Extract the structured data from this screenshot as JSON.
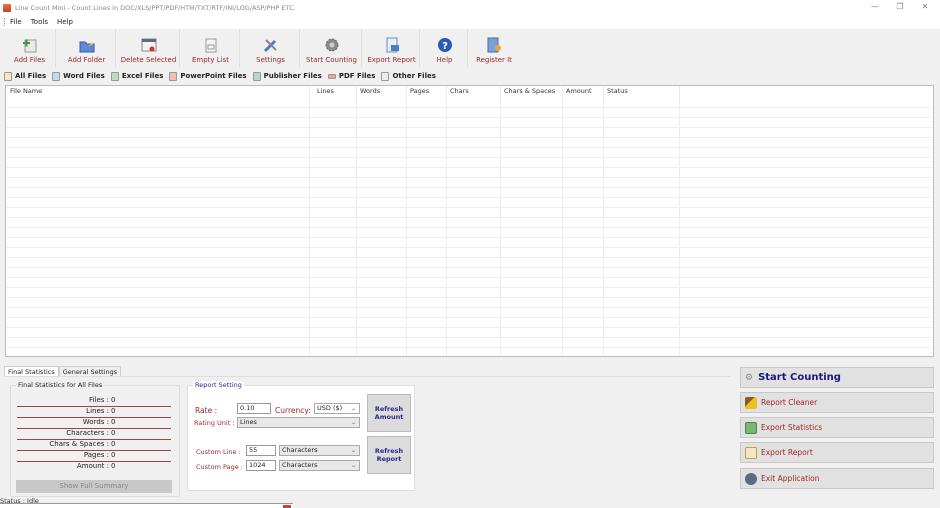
{
  "window": {
    "title": "Line Count Mini - Count Lines in DOC/XLS/PPT/PDF/HTM/TXT/RTF/INI/LOG/ASP/PHP ETC.",
    "minimize": "—",
    "restore": "❐",
    "close": "✕"
  },
  "menu": [
    "File",
    "Tools",
    "Help"
  ],
  "toolbar": [
    {
      "label": "Add Files",
      "icon": "add-files-icon"
    },
    {
      "label": "Add Folder",
      "icon": "add-folder-icon"
    },
    {
      "label": "Delete Selected",
      "icon": "delete-selected-icon"
    },
    {
      "label": "Empty List",
      "icon": "empty-list-icon"
    },
    {
      "label": "Settings",
      "icon": "settings-icon"
    },
    {
      "label": "Start Counting",
      "icon": "gear-icon"
    },
    {
      "label": "Export Report",
      "icon": "export-report-icon"
    },
    {
      "label": "Help",
      "icon": "help-icon"
    },
    {
      "label": "Register It",
      "icon": "register-icon"
    }
  ],
  "file_tabs": [
    {
      "label": "All Files",
      "color": "#d8c080"
    },
    {
      "label": "Word Files",
      "color": "#3a6fc8"
    },
    {
      "label": "Excel Files",
      "color": "#3a9a4a"
    },
    {
      "label": "PowerPoint Files",
      "color": "#d04a30"
    },
    {
      "label": "Publisher Files",
      "color": "#2a8a7a"
    },
    {
      "label": "PDF Files",
      "color": "#e04040"
    },
    {
      "label": "Other Files",
      "color": "#c8c8c8"
    }
  ],
  "grid": {
    "columns": [
      "File Name",
      "Lines",
      "Words",
      "Pages",
      "Chars",
      "Chars & Spaces",
      "Amount",
      "Status"
    ],
    "rows": []
  },
  "bottom_tabs": [
    "Final Statistics",
    "General Settings"
  ],
  "final_stats": {
    "legend": "Final Statistics for All Files",
    "rows": [
      {
        "label": "Files :",
        "value": "0"
      },
      {
        "label": "Lines :",
        "value": "0"
      },
      {
        "label": "Words :",
        "value": "0"
      },
      {
        "label": "Characters :",
        "value": "0"
      },
      {
        "label": "Chars & Spaces :",
        "value": "0"
      },
      {
        "label": "Pages :",
        "value": "0"
      },
      {
        "label": "Amount :",
        "value": "0"
      }
    ],
    "summary_button": "Show Full Summary"
  },
  "report_setting": {
    "legend": "Report Setting",
    "rate_label": "Rate :",
    "rate_value": "0.10",
    "currency_label": "Currency:",
    "currency_value": "USD ($)",
    "rating_unit_label": "Rating Unit :",
    "rating_unit_value": "Lines",
    "custom_line_label": "Custom Line :",
    "custom_line_value": "55",
    "custom_line_unit": "Characters",
    "custom_page_label": "Custom Page :",
    "custom_page_value": "1024",
    "custom_page_unit": "Characters",
    "refresh_amount": "Refresh Amount",
    "refresh_report": "Refresh Report"
  },
  "actions": [
    {
      "label": "Start Counting"
    },
    {
      "label": "Report Cleaner"
    },
    {
      "label": "Export Statistics"
    },
    {
      "label": "Export Report"
    },
    {
      "label": "Exit Application"
    }
  ],
  "status": "Status : Idle"
}
